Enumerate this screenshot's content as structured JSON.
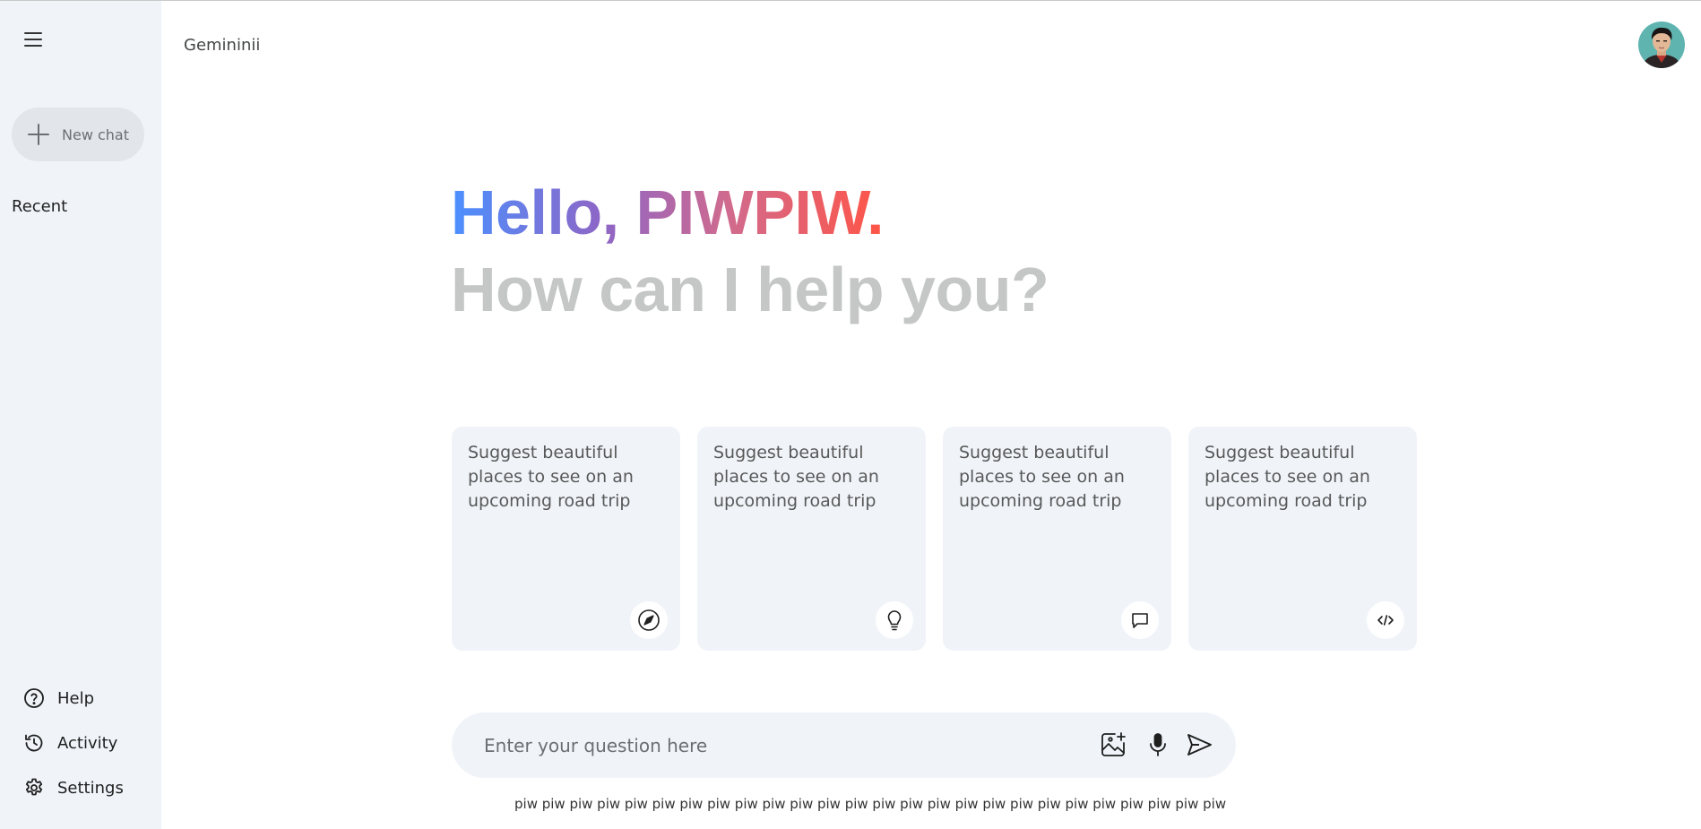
{
  "app": {
    "title": "Gemininii"
  },
  "sidebar": {
    "new_chat_label": "New chat",
    "recent_label": "Recent",
    "bottom_items": [
      {
        "label": "Help",
        "icon": "help-icon"
      },
      {
        "label": "Activity",
        "icon": "history-icon"
      },
      {
        "label": "Settings",
        "icon": "gear-icon"
      }
    ]
  },
  "greeting": {
    "hello": "Hello, PIWPIW.",
    "subtitle": "How can I help you?"
  },
  "cards": [
    {
      "text": "Suggest beautiful places to see on an upcoming road trip",
      "icon": "compass-icon"
    },
    {
      "text": "Suggest beautiful places to see on an upcoming road trip",
      "icon": "lightbulb-icon"
    },
    {
      "text": "Suggest beautiful places to see on an upcoming road trip",
      "icon": "message-icon"
    },
    {
      "text": "Suggest beautiful places to see on an upcoming road trip",
      "icon": "code-icon"
    }
  ],
  "input": {
    "placeholder": "Enter your question here",
    "value": ""
  },
  "footer": {
    "text": "piw piw piw piw piw piw piw piw piw piw piw piw piw piw piw piw piw piw piw piw piw piw piw piw piw piw"
  },
  "colors": {
    "sidebar_bg": "#f0f4f9",
    "card_bg": "#f0f4f9",
    "gradient_start": "#4b90ff",
    "gradient_end": "#ff5546",
    "subtitle": "#c4c7c5"
  }
}
